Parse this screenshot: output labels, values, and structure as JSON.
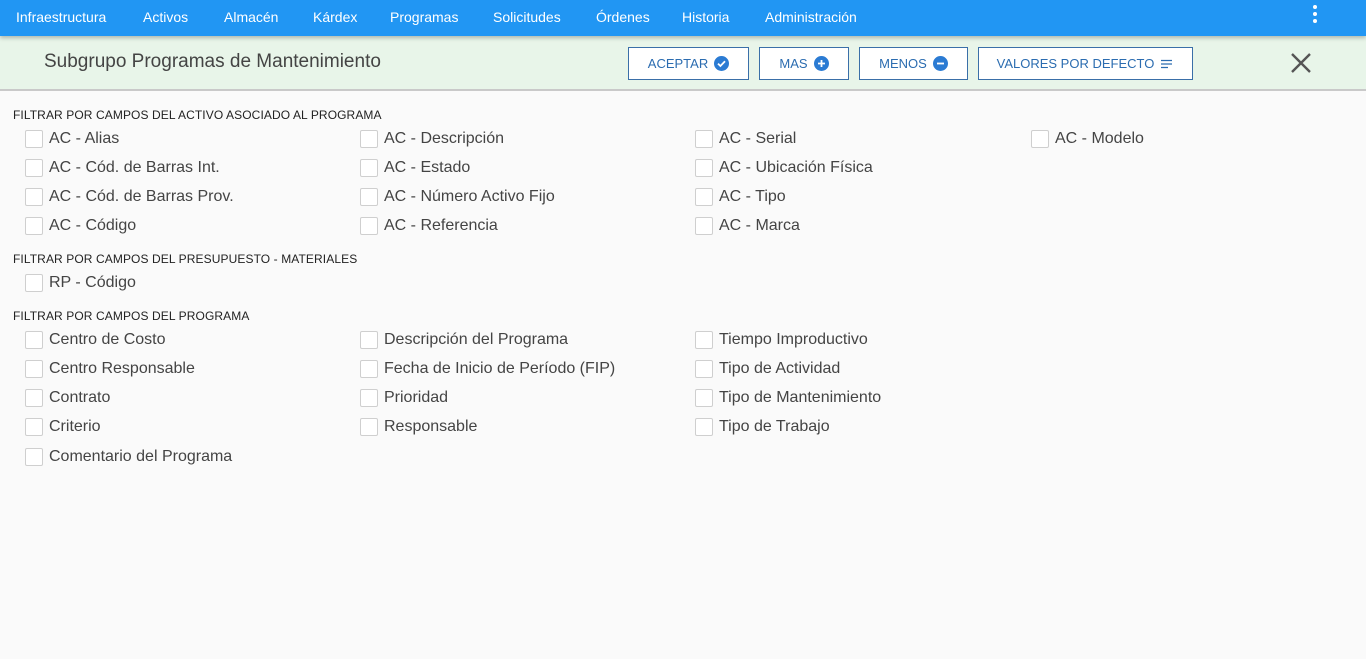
{
  "nav": {
    "items": [
      "Infraestructura",
      "Activos",
      "Almacén",
      "Kárdex",
      "Programas",
      "Solicitudes",
      "Órdenes",
      "Historia",
      "Administración"
    ]
  },
  "header": {
    "title": "Subgrupo Programas de Mantenimiento",
    "buttons": {
      "accept": "ACEPTAR",
      "more": "MAS",
      "less": "MENOS",
      "defaults": "VALORES POR DEFECTO"
    }
  },
  "sections": [
    {
      "title": "FILTRAR POR CAMPOS DEL ACTIVO ASOCIADO AL PROGRAMA",
      "columns": [
        [
          "AC - Alias",
          "AC - Cód. de Barras Int.",
          "AC - Cód. de Barras Prov.",
          "AC - Código"
        ],
        [
          "AC - Descripción",
          "AC - Estado",
          "AC - Número Activo Fijo",
          "AC - Referencia"
        ],
        [
          "AC - Serial",
          "AC - Ubicación Física",
          "AC - Tipo",
          "AC - Marca"
        ],
        [
          "AC - Modelo"
        ]
      ]
    },
    {
      "title": "FILTRAR POR CAMPOS DEL PRESUPUESTO - MATERIALES",
      "columns": [
        [
          "RP - Código"
        ]
      ]
    },
    {
      "title": "FILTRAR POR CAMPOS DEL PROGRAMA",
      "columns": [
        [
          "Centro de Costo",
          "Centro Responsable",
          "Contrato",
          "Criterio",
          "Comentario del Programa"
        ],
        [
          "Descripción del Programa",
          "Fecha de Inicio de Período (FIP)",
          "Prioridad",
          "Responsable"
        ],
        [
          "Tiempo Improductivo",
          "Tipo de Actividad",
          "Tipo de Mantenimiento",
          "Tipo de Trabajo"
        ]
      ]
    }
  ]
}
